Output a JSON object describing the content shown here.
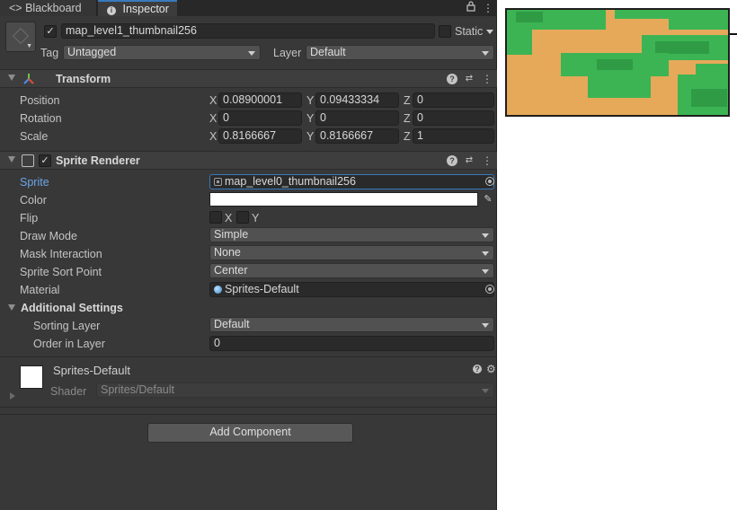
{
  "tabs": {
    "blackboard": "Blackboard",
    "blackboard_icon": "<>",
    "inspector": "Inspector"
  },
  "header": {
    "object_name": "map_level1_thumbnail256",
    "static_label": "Static",
    "tag_label": "Tag",
    "tag_value": "Untagged",
    "layer_label": "Layer",
    "layer_value": "Default"
  },
  "transform": {
    "title": "Transform",
    "position_label": "Position",
    "position": {
      "x": "0.08900001",
      "y": "0.09433334",
      "z": "0"
    },
    "rotation_label": "Rotation",
    "rotation": {
      "x": "0",
      "y": "0",
      "z": "0"
    },
    "scale_label": "Scale",
    "scale": {
      "x": "0.8166667",
      "y": "0.8166667",
      "z": "1"
    },
    "axis": {
      "x": "X",
      "y": "Y",
      "z": "Z"
    }
  },
  "sprite_renderer": {
    "title": "Sprite Renderer",
    "sprite_label": "Sprite",
    "sprite_value": "map_level0_thumbnail256",
    "color_label": "Color",
    "color_value": "#ffffff",
    "flip_label": "Flip",
    "flip_x": "X",
    "flip_y": "Y",
    "draw_mode_label": "Draw Mode",
    "draw_mode_value": "Simple",
    "mask_label": "Mask Interaction",
    "mask_value": "None",
    "sort_point_label": "Sprite Sort Point",
    "sort_point_value": "Center",
    "material_label": "Material",
    "material_value": "Sprites-Default",
    "additional_label": "Additional Settings",
    "sorting_layer_label": "Sorting Layer",
    "sorting_layer_value": "Default",
    "order_label": "Order in Layer",
    "order_value": "0"
  },
  "material": {
    "name": "Sprites-Default",
    "shader_label": "Shader",
    "shader_value": "Sprites/Default"
  },
  "add_component": "Add Component",
  "colors": {
    "panel": "#383838",
    "accent": "#3a79bb",
    "sprite_label": "#6ca6e8",
    "grass": "#3cb454",
    "sand": "#e6a95a"
  }
}
